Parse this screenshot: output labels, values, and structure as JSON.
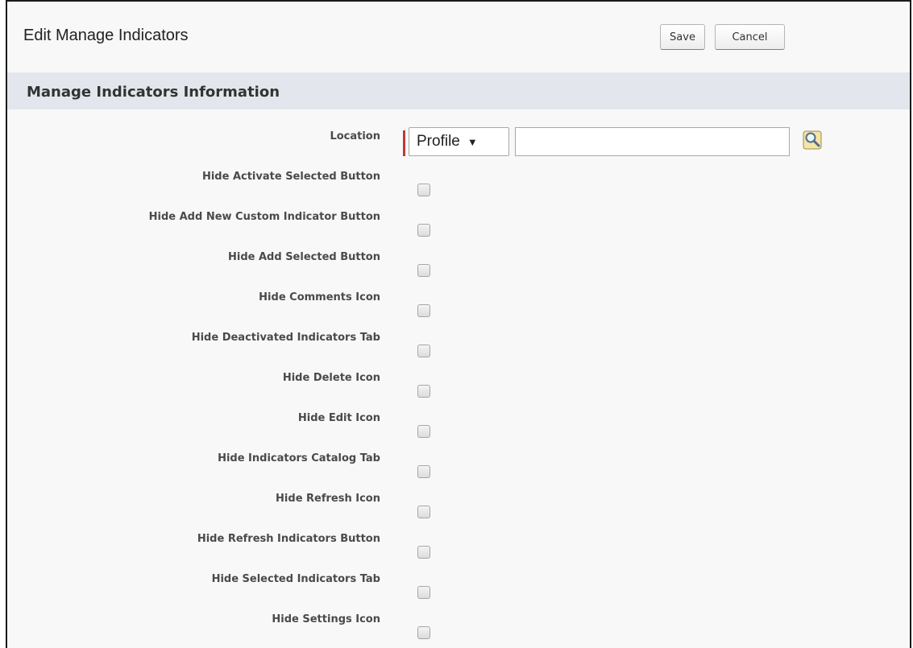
{
  "header": {
    "title": "Edit Manage Indicators",
    "save_label": "Save",
    "cancel_label": "Cancel"
  },
  "section": {
    "title": "Manage Indicators Information"
  },
  "location": {
    "label": "Location",
    "select_value": "Profile",
    "input_value": "",
    "lookup_icon": "magnifier-lookup-icon"
  },
  "fields": [
    {
      "label": "Hide Activate Selected Button",
      "checked": false
    },
    {
      "label": "Hide Add New Custom Indicator Button",
      "checked": false
    },
    {
      "label": "Hide Add Selected Button",
      "checked": false
    },
    {
      "label": "Hide Comments Icon",
      "checked": false
    },
    {
      "label": "Hide Deactivated Indicators Tab",
      "checked": false
    },
    {
      "label": "Hide Delete Icon",
      "checked": false
    },
    {
      "label": "Hide Edit Icon",
      "checked": false
    },
    {
      "label": "Hide Indicators Catalog Tab",
      "checked": false
    },
    {
      "label": "Hide Refresh Icon",
      "checked": false
    },
    {
      "label": "Hide Refresh Indicators Button",
      "checked": false
    },
    {
      "label": "Hide Selected Indicators Tab",
      "checked": false
    },
    {
      "label": "Hide Settings Icon",
      "checked": false
    }
  ],
  "colors": {
    "required": "#c23934",
    "section_bg": "#e3e7ed",
    "page_bg": "#f8f8f8"
  }
}
